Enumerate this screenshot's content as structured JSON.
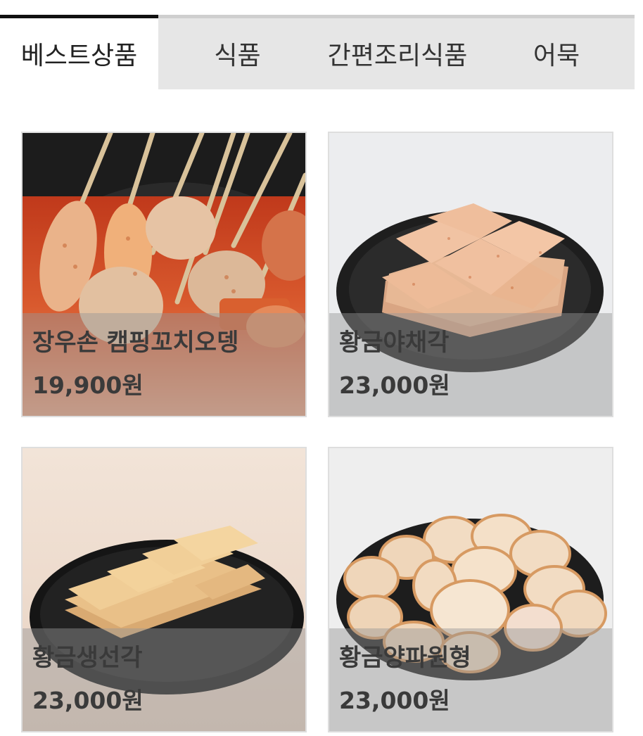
{
  "tabs": [
    {
      "label": "베스트상품",
      "active": true
    },
    {
      "label": "식품",
      "active": false
    },
    {
      "label": "간편조리식품",
      "active": false
    },
    {
      "label": "어묵",
      "active": false
    }
  ],
  "products": [
    {
      "name": "장우손 캠핑꼬치오뎅",
      "price": "19,900원",
      "image": "skewered-fishcake-in-spicy-broth"
    },
    {
      "name": "황금야채각",
      "price": "23,000원",
      "image": "stacked-square-fishcake-on-black-plate"
    },
    {
      "name": "황금생선각",
      "price": "23,000원",
      "image": "stacked-rectangular-fishcake-on-black-plate"
    },
    {
      "name": "황금양파원형",
      "price": "23,000원",
      "image": "round-fishcake-slices-on-black-plate"
    }
  ]
}
